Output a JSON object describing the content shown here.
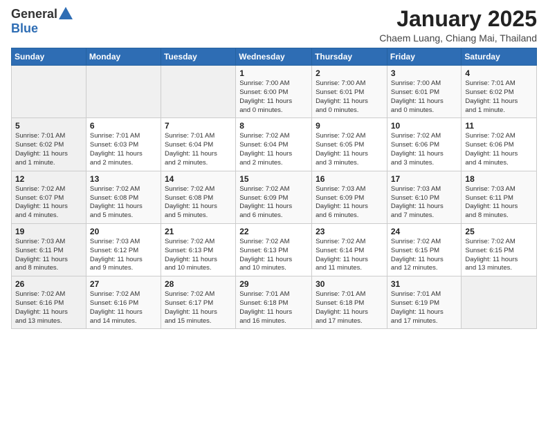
{
  "header": {
    "logo_general": "General",
    "logo_blue": "Blue",
    "month_year": "January 2025",
    "location": "Chaem Luang, Chiang Mai, Thailand"
  },
  "weekdays": [
    "Sunday",
    "Monday",
    "Tuesday",
    "Wednesday",
    "Thursday",
    "Friday",
    "Saturday"
  ],
  "weeks": [
    [
      {
        "day": "",
        "info": ""
      },
      {
        "day": "",
        "info": ""
      },
      {
        "day": "",
        "info": ""
      },
      {
        "day": "1",
        "info": "Sunrise: 7:00 AM\nSunset: 6:00 PM\nDaylight: 11 hours\nand 0 minutes."
      },
      {
        "day": "2",
        "info": "Sunrise: 7:00 AM\nSunset: 6:01 PM\nDaylight: 11 hours\nand 0 minutes."
      },
      {
        "day": "3",
        "info": "Sunrise: 7:00 AM\nSunset: 6:01 PM\nDaylight: 11 hours\nand 0 minutes."
      },
      {
        "day": "4",
        "info": "Sunrise: 7:01 AM\nSunset: 6:02 PM\nDaylight: 11 hours\nand 1 minute."
      }
    ],
    [
      {
        "day": "5",
        "info": "Sunrise: 7:01 AM\nSunset: 6:02 PM\nDaylight: 11 hours\nand 1 minute."
      },
      {
        "day": "6",
        "info": "Sunrise: 7:01 AM\nSunset: 6:03 PM\nDaylight: 11 hours\nand 2 minutes."
      },
      {
        "day": "7",
        "info": "Sunrise: 7:01 AM\nSunset: 6:04 PM\nDaylight: 11 hours\nand 2 minutes."
      },
      {
        "day": "8",
        "info": "Sunrise: 7:02 AM\nSunset: 6:04 PM\nDaylight: 11 hours\nand 2 minutes."
      },
      {
        "day": "9",
        "info": "Sunrise: 7:02 AM\nSunset: 6:05 PM\nDaylight: 11 hours\nand 3 minutes."
      },
      {
        "day": "10",
        "info": "Sunrise: 7:02 AM\nSunset: 6:06 PM\nDaylight: 11 hours\nand 3 minutes."
      },
      {
        "day": "11",
        "info": "Sunrise: 7:02 AM\nSunset: 6:06 PM\nDaylight: 11 hours\nand 4 minutes."
      }
    ],
    [
      {
        "day": "12",
        "info": "Sunrise: 7:02 AM\nSunset: 6:07 PM\nDaylight: 11 hours\nand 4 minutes."
      },
      {
        "day": "13",
        "info": "Sunrise: 7:02 AM\nSunset: 6:08 PM\nDaylight: 11 hours\nand 5 minutes."
      },
      {
        "day": "14",
        "info": "Sunrise: 7:02 AM\nSunset: 6:08 PM\nDaylight: 11 hours\nand 5 minutes."
      },
      {
        "day": "15",
        "info": "Sunrise: 7:02 AM\nSunset: 6:09 PM\nDaylight: 11 hours\nand 6 minutes."
      },
      {
        "day": "16",
        "info": "Sunrise: 7:03 AM\nSunset: 6:09 PM\nDaylight: 11 hours\nand 6 minutes."
      },
      {
        "day": "17",
        "info": "Sunrise: 7:03 AM\nSunset: 6:10 PM\nDaylight: 11 hours\nand 7 minutes."
      },
      {
        "day": "18",
        "info": "Sunrise: 7:03 AM\nSunset: 6:11 PM\nDaylight: 11 hours\nand 8 minutes."
      }
    ],
    [
      {
        "day": "19",
        "info": "Sunrise: 7:03 AM\nSunset: 6:11 PM\nDaylight: 11 hours\nand 8 minutes."
      },
      {
        "day": "20",
        "info": "Sunrise: 7:03 AM\nSunset: 6:12 PM\nDaylight: 11 hours\nand 9 minutes."
      },
      {
        "day": "21",
        "info": "Sunrise: 7:02 AM\nSunset: 6:13 PM\nDaylight: 11 hours\nand 10 minutes."
      },
      {
        "day": "22",
        "info": "Sunrise: 7:02 AM\nSunset: 6:13 PM\nDaylight: 11 hours\nand 10 minutes."
      },
      {
        "day": "23",
        "info": "Sunrise: 7:02 AM\nSunset: 6:14 PM\nDaylight: 11 hours\nand 11 minutes."
      },
      {
        "day": "24",
        "info": "Sunrise: 7:02 AM\nSunset: 6:15 PM\nDaylight: 11 hours\nand 12 minutes."
      },
      {
        "day": "25",
        "info": "Sunrise: 7:02 AM\nSunset: 6:15 PM\nDaylight: 11 hours\nand 13 minutes."
      }
    ],
    [
      {
        "day": "26",
        "info": "Sunrise: 7:02 AM\nSunset: 6:16 PM\nDaylight: 11 hours\nand 13 minutes."
      },
      {
        "day": "27",
        "info": "Sunrise: 7:02 AM\nSunset: 6:16 PM\nDaylight: 11 hours\nand 14 minutes."
      },
      {
        "day": "28",
        "info": "Sunrise: 7:02 AM\nSunset: 6:17 PM\nDaylight: 11 hours\nand 15 minutes."
      },
      {
        "day": "29",
        "info": "Sunrise: 7:01 AM\nSunset: 6:18 PM\nDaylight: 11 hours\nand 16 minutes."
      },
      {
        "day": "30",
        "info": "Sunrise: 7:01 AM\nSunset: 6:18 PM\nDaylight: 11 hours\nand 17 minutes."
      },
      {
        "day": "31",
        "info": "Sunrise: 7:01 AM\nSunset: 6:19 PM\nDaylight: 11 hours\nand 17 minutes."
      },
      {
        "day": "",
        "info": ""
      }
    ]
  ]
}
